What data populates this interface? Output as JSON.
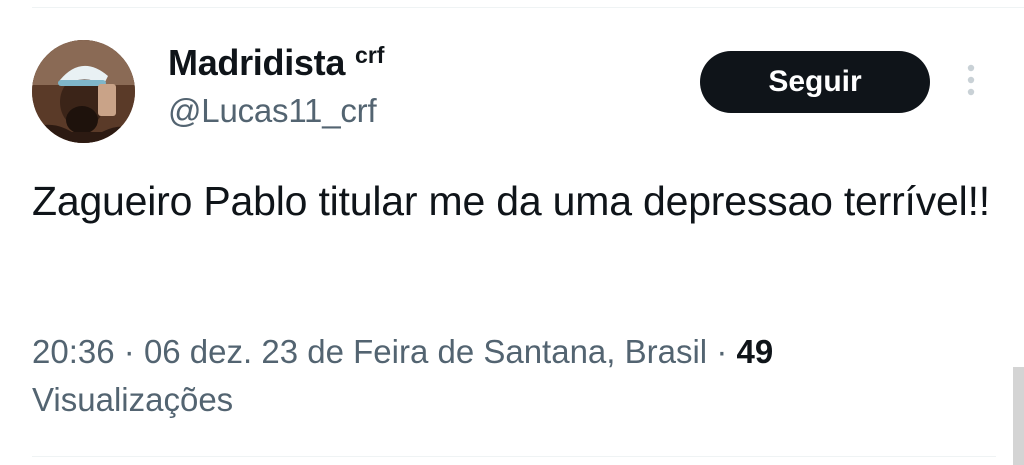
{
  "tweet": {
    "author": {
      "display_name": "Madridista",
      "name_suffix": "crf",
      "handle": "@Lucas11_crf"
    },
    "follow_label": "Seguir",
    "text": "Zagueiro Pablo titular me da uma depressao terrível!!",
    "meta": {
      "time": "20:36",
      "separator": "·",
      "date": "06 dez. 23",
      "location": "de Feira de Santana, Brasil",
      "views_count": "49",
      "views_label": "Visualizações"
    }
  },
  "colors": {
    "primary_text": "#0f1419",
    "secondary_text": "#536471",
    "button_bg": "#0f1419",
    "button_text": "#ffffff",
    "divider": "#eff3f4"
  },
  "icons": {
    "more": "more-vertical-icon"
  }
}
